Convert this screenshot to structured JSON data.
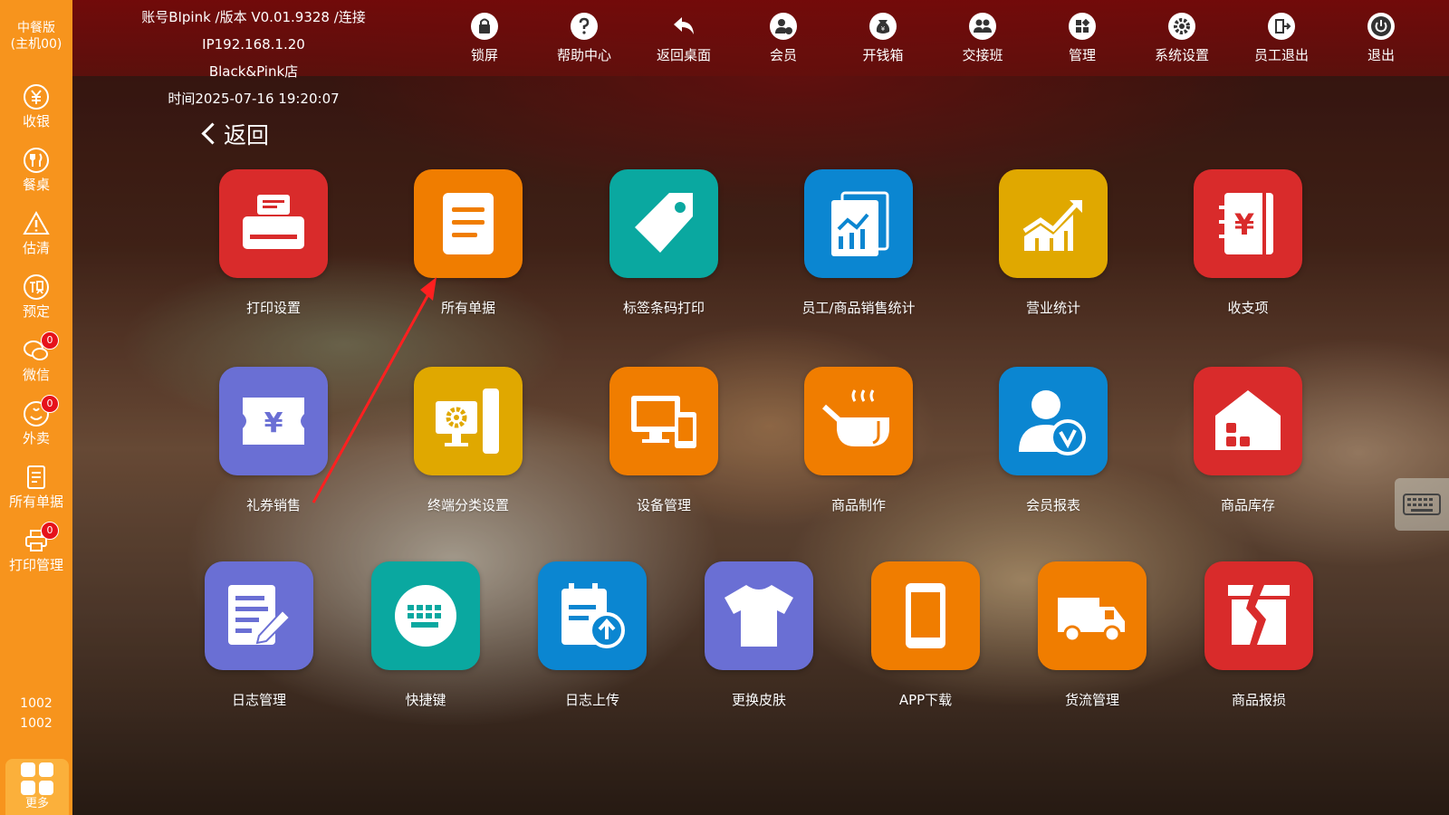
{
  "sidebar": {
    "brand_line1": "中餐版",
    "brand_line2": "(主机00)",
    "items": [
      {
        "label": "收银",
        "icon": "yen-circle-icon"
      },
      {
        "label": "餐桌",
        "icon": "cutlery-icon"
      },
      {
        "label": "估清",
        "icon": "warning-icon"
      },
      {
        "label": "预定",
        "icon": "reserve-icon"
      },
      {
        "label": "微信",
        "icon": "wechat-icon",
        "badge": "0"
      },
      {
        "label": "外卖",
        "icon": "delivery-icon",
        "badge": "0"
      },
      {
        "label": "所有单据",
        "icon": "document-icon"
      },
      {
        "label": "打印管理",
        "icon": "printer-icon",
        "badge": "0"
      }
    ],
    "id_line1": "1002",
    "id_line2": "1002",
    "more_label": "更多"
  },
  "header": {
    "account_line": "账号BIpink /版本 V0.01.9328 /连接IP192.168.1.20",
    "store_line": "Black&Pink店",
    "time_line": "时间2025-07-16 19:20:07",
    "buttons": [
      {
        "label": "锁屏",
        "icon": "lock-icon"
      },
      {
        "label": "帮助中心",
        "icon": "help-icon"
      },
      {
        "label": "返回桌面",
        "icon": "return-icon"
      },
      {
        "label": "会员",
        "icon": "member-icon"
      },
      {
        "label": "开钱箱",
        "icon": "cash-box-icon"
      },
      {
        "label": "交接班",
        "icon": "shift-icon"
      },
      {
        "label": "管理",
        "icon": "manage-icon"
      },
      {
        "label": "系统设置",
        "icon": "settings-icon"
      },
      {
        "label": "员工退出",
        "icon": "staff-exit-icon"
      },
      {
        "label": "退出",
        "icon": "power-icon"
      }
    ]
  },
  "main": {
    "back_label": "返回",
    "tiles": [
      {
        "label": "打印设置",
        "icon": "printer-icon",
        "color": "#d92b2b"
      },
      {
        "label": "所有单据",
        "icon": "document-list-icon",
        "color": "#f07d00"
      },
      {
        "label": "标签条码打印",
        "icon": "tag-icon",
        "color": "#0aa8a0"
      },
      {
        "label": "员工/商品销售统计",
        "icon": "report-chart-icon",
        "color": "#0b86d1"
      },
      {
        "label": "营业统计",
        "icon": "growth-chart-icon",
        "color": "#e0a800"
      },
      {
        "label": "收支项",
        "icon": "ledger-yen-icon",
        "color": "#d92b2b"
      },
      {
        "label": "礼券销售",
        "icon": "coupon-icon",
        "color": "#6a6fd4"
      },
      {
        "label": "终端分类设置",
        "icon": "terminal-gear-icon",
        "color": "#e0a800"
      },
      {
        "label": "设备管理",
        "icon": "devices-icon",
        "color": "#f07d00"
      },
      {
        "label": "商品制作",
        "icon": "cooking-pot-icon",
        "color": "#f07d00"
      },
      {
        "label": "会员报表",
        "icon": "member-verified-icon",
        "color": "#0b86d1"
      },
      {
        "label": "商品库存",
        "icon": "warehouse-icon",
        "color": "#d92b2b"
      },
      {
        "label": "日志管理",
        "icon": "edit-log-icon",
        "color": "#6a6fd4"
      },
      {
        "label": "快捷键",
        "icon": "keyboard-icon",
        "color": "#0aa8a0"
      },
      {
        "label": "日志上传",
        "icon": "calendar-upload-icon",
        "color": "#0b86d1"
      },
      {
        "label": "更换皮肤",
        "icon": "tshirt-icon",
        "color": "#6a6fd4"
      },
      {
        "label": "APP下载",
        "icon": "phone-icon",
        "color": "#f07d00"
      },
      {
        "label": "货流管理",
        "icon": "truck-icon",
        "color": "#f07d00"
      },
      {
        "label": "商品报损",
        "icon": "broken-box-icon",
        "color": "#d92b2b"
      }
    ]
  }
}
